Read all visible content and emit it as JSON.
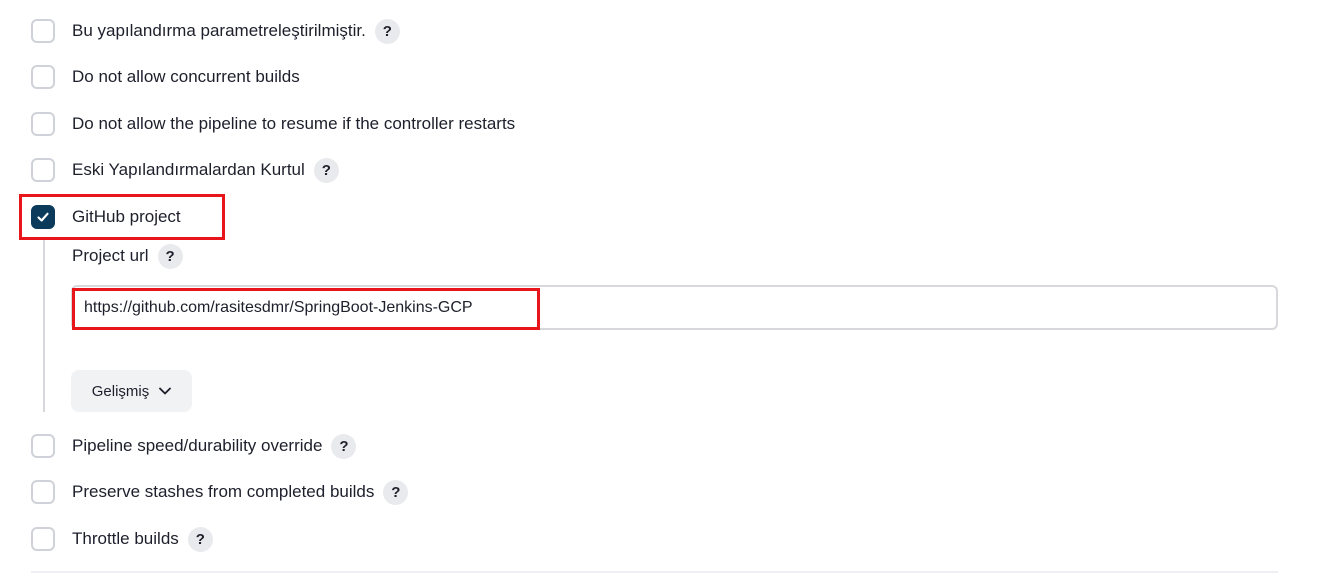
{
  "options": [
    {
      "label": "Bu yapılandırma parametreleştirilmiştir.",
      "checked": false,
      "help": "?"
    },
    {
      "label": "Do not allow concurrent builds",
      "checked": false
    },
    {
      "label": "Do not allow the pipeline to resume if the controller restarts",
      "checked": false
    },
    {
      "label": "Eski Yapılandırmalardan Kurtul",
      "checked": false,
      "help": "?"
    },
    {
      "label": "GitHub project",
      "checked": true
    },
    {
      "label": "Pipeline speed/durability override",
      "checked": false,
      "help": "?"
    },
    {
      "label": "Preserve stashes from completed builds",
      "checked": false,
      "help": "?"
    },
    {
      "label": "Throttle builds",
      "checked": false,
      "help": "?"
    }
  ],
  "github_project": {
    "project_url_label": "Project url",
    "project_url_help": "?",
    "project_url_value": "https://github.com/rasitesdmr/SpringBoot-Jenkins-GCP",
    "advanced_label": "Gelişmiş"
  },
  "icons": {
    "checkmark": "check-icon",
    "help": "help-icon",
    "chevron": "chevron-down-icon"
  },
  "colors": {
    "checked_fill": "#0b3a5a",
    "highlight_border": "#e8151b",
    "checkbox_border": "#cfd2d8",
    "help_bg": "#e9eaed"
  }
}
